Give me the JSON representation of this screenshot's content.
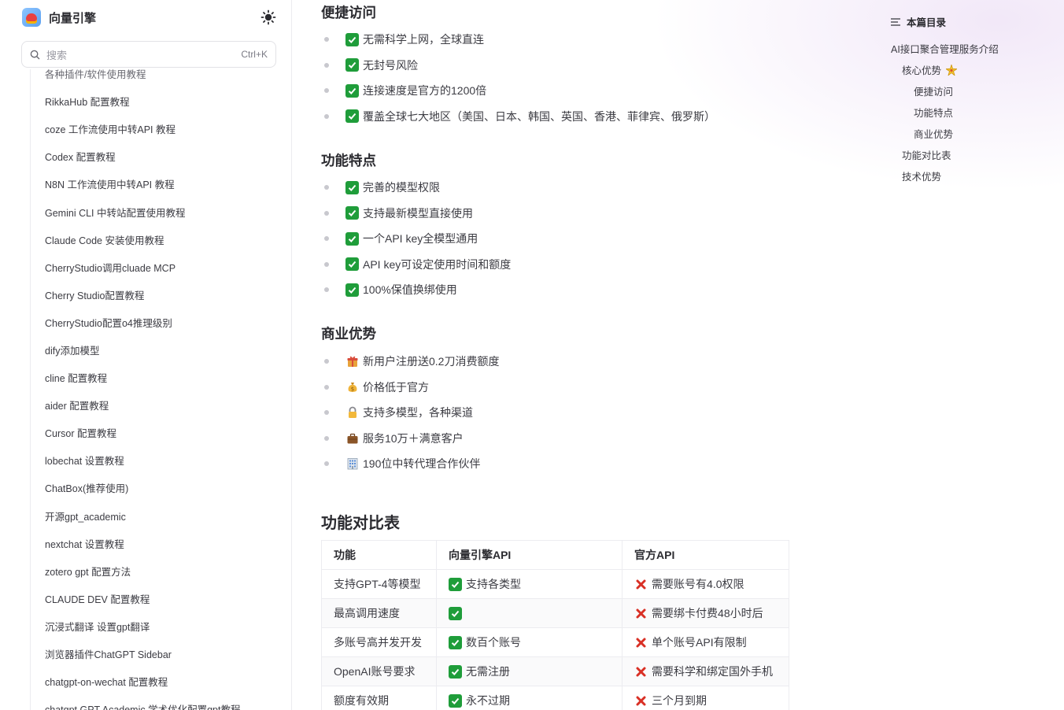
{
  "brand": {
    "name": "向量引擎"
  },
  "search": {
    "placeholder": "搜索",
    "shortcut": "Ctrl+K"
  },
  "sidebar": {
    "items": [
      "各种插件/软件使用教程",
      "RikkaHub 配置教程",
      "coze 工作流使用中转API 教程",
      "Codex 配置教程",
      "N8N 工作流使用中转API 教程",
      "Gemini CLI 中转站配置使用教程",
      "Claude Code 安装使用教程",
      "CherryStudio调用cluade MCP",
      "Cherry Studio配置教程",
      "CherryStudio配置o4推理级别",
      "dify添加模型",
      "cline 配置教程",
      "aider 配置教程",
      "Cursor 配置教程",
      "lobechat 设置教程",
      "ChatBox(推荐使用)",
      "开源gpt_academic",
      "nextchat 设置教程",
      "zotero gpt 配置方法",
      "CLAUDE DEV 配置教程",
      "沉浸式翻译 设置gpt翻译",
      "浏览器插件ChatGPT Sidebar",
      "chatgpt-on-wechat 配置教程",
      "chatgpt GPT Academic 学术优化配置gpt教程"
    ]
  },
  "content": {
    "access": {
      "title": "便捷访问",
      "items": [
        "无需科学上网，全球直连",
        "无封号风险",
        "连接速度是官方的1200倍",
        "覆盖全球七大地区（美国、日本、韩国、英国、香港、菲律宾、俄罗斯）"
      ]
    },
    "features": {
      "title": "功能特点",
      "items": [
        "完善的模型权限",
        "支持最新模型直接使用",
        "一个API key全模型通用",
        "API key可设定使用时间和额度",
        "100%保值换绑使用"
      ]
    },
    "business": {
      "title": "商业优势",
      "items": [
        {
          "icon": "gift-icon",
          "text": "新用户注册送0.2刀消费额度"
        },
        {
          "icon": "money-bag-icon",
          "text": "价格低于官方"
        },
        {
          "icon": "lock-icon",
          "text": "支持多模型，各种渠道"
        },
        {
          "icon": "briefcase-icon",
          "text": "服务10万＋满意客户"
        },
        {
          "icon": "office-building-icon",
          "text": "190位中转代理合作伙伴"
        }
      ]
    },
    "compare": {
      "title": "功能对比表",
      "headers": [
        "功能",
        "向量引擎API",
        "官方API"
      ],
      "rows": [
        [
          "支持GPT-4等模型",
          "支持各类型",
          "需要账号有4.0权限"
        ],
        [
          "最高调用速度",
          "",
          "需要绑卡付费48小时后"
        ],
        [
          "多账号高并发开发",
          "数百个账号",
          "单个账号API有限制"
        ],
        [
          "OpenAI账号要求",
          "无需注册",
          "需要科学和绑定国外手机"
        ],
        [
          "额度有效期",
          "永不过期",
          "三个月到期"
        ]
      ]
    }
  },
  "toc": {
    "title": "本篇目录",
    "items": [
      "AI接口聚合管理服务介绍",
      "核心优势",
      "便捷访问",
      "功能特点",
      "商业优势",
      "功能对比表",
      "技术优势"
    ]
  },
  "colors": {
    "check_green": "#1f9d3a",
    "cross_red": "#d93025",
    "text": "#3c3c43",
    "heading": "#2b2b30"
  }
}
